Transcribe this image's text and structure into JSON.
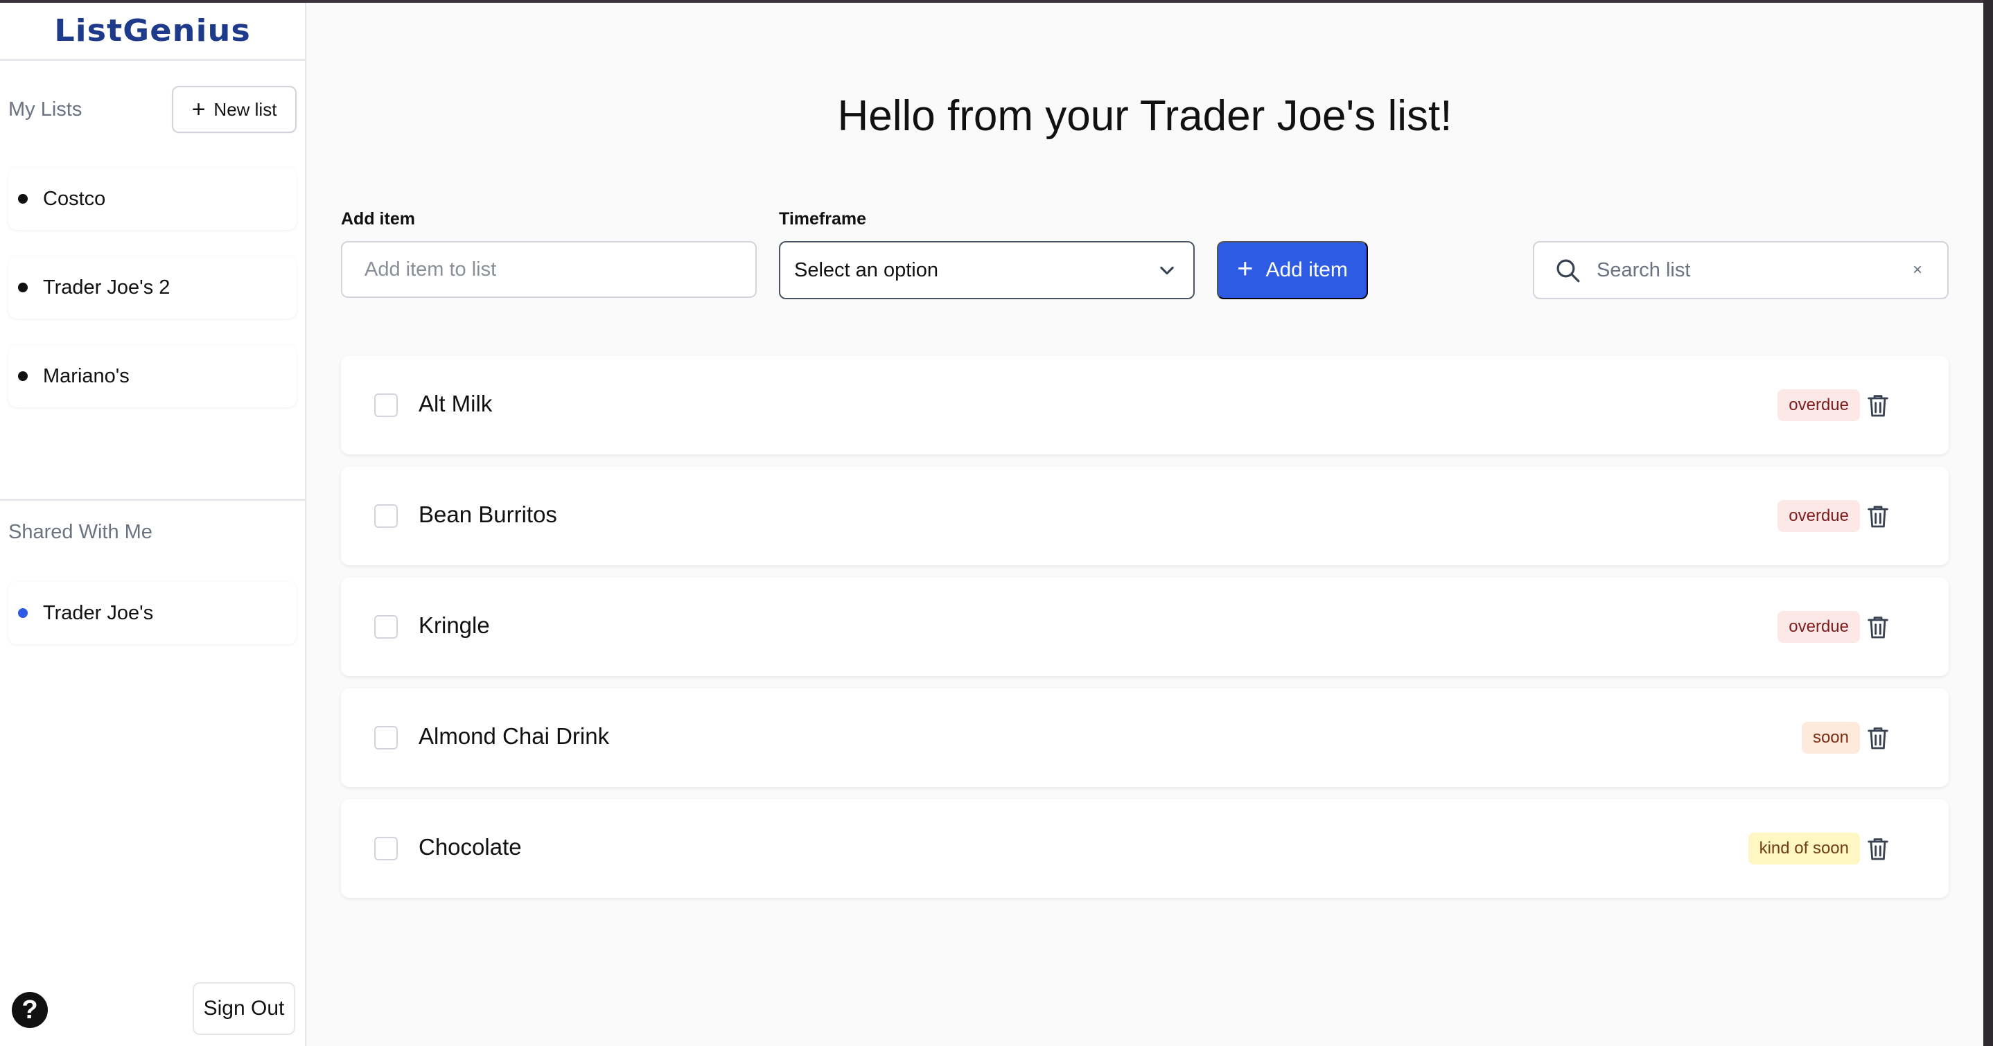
{
  "app": {
    "logo": "ListGenius"
  },
  "sidebar": {
    "my_lists_title": "My Lists",
    "new_list_label": "New list",
    "lists": [
      {
        "label": "Costco"
      },
      {
        "label": "Trader Joe's 2"
      },
      {
        "label": "Mariano's"
      }
    ],
    "shared_title": "Shared With Me",
    "shared": [
      {
        "label": "Trader Joe's"
      }
    ],
    "help_icon": "question-circle-icon",
    "sign_out_label": "Sign Out"
  },
  "main": {
    "title": "Hello from your Trader Joe's list!",
    "add_item_label": "Add item",
    "add_item_placeholder": "Add item to list",
    "add_item_value": "",
    "timeframe_label": "Timeframe",
    "timeframe_selected": "Select an option",
    "add_button_label": "Add item",
    "search_placeholder": "Search list",
    "search_value": "",
    "clear_symbol": "×",
    "items": [
      {
        "name": "Alt Milk",
        "status": "overdue",
        "checked": false
      },
      {
        "name": "Bean Burritos",
        "status": "overdue",
        "checked": false
      },
      {
        "name": "Kringle",
        "status": "overdue",
        "checked": false
      },
      {
        "name": "Almond Chai Drink",
        "status": "soon",
        "checked": false
      },
      {
        "name": "Chocolate",
        "status": "kind of soon",
        "checked": false
      }
    ]
  },
  "colors": {
    "accent": "#2d5be3",
    "logo": "#1e3a8a",
    "overdue_bg": "#fde8e8",
    "soon_bg": "#feeadc",
    "kind_of_soon_bg": "#fef6c3",
    "shared_dot": "#2d5be3"
  }
}
